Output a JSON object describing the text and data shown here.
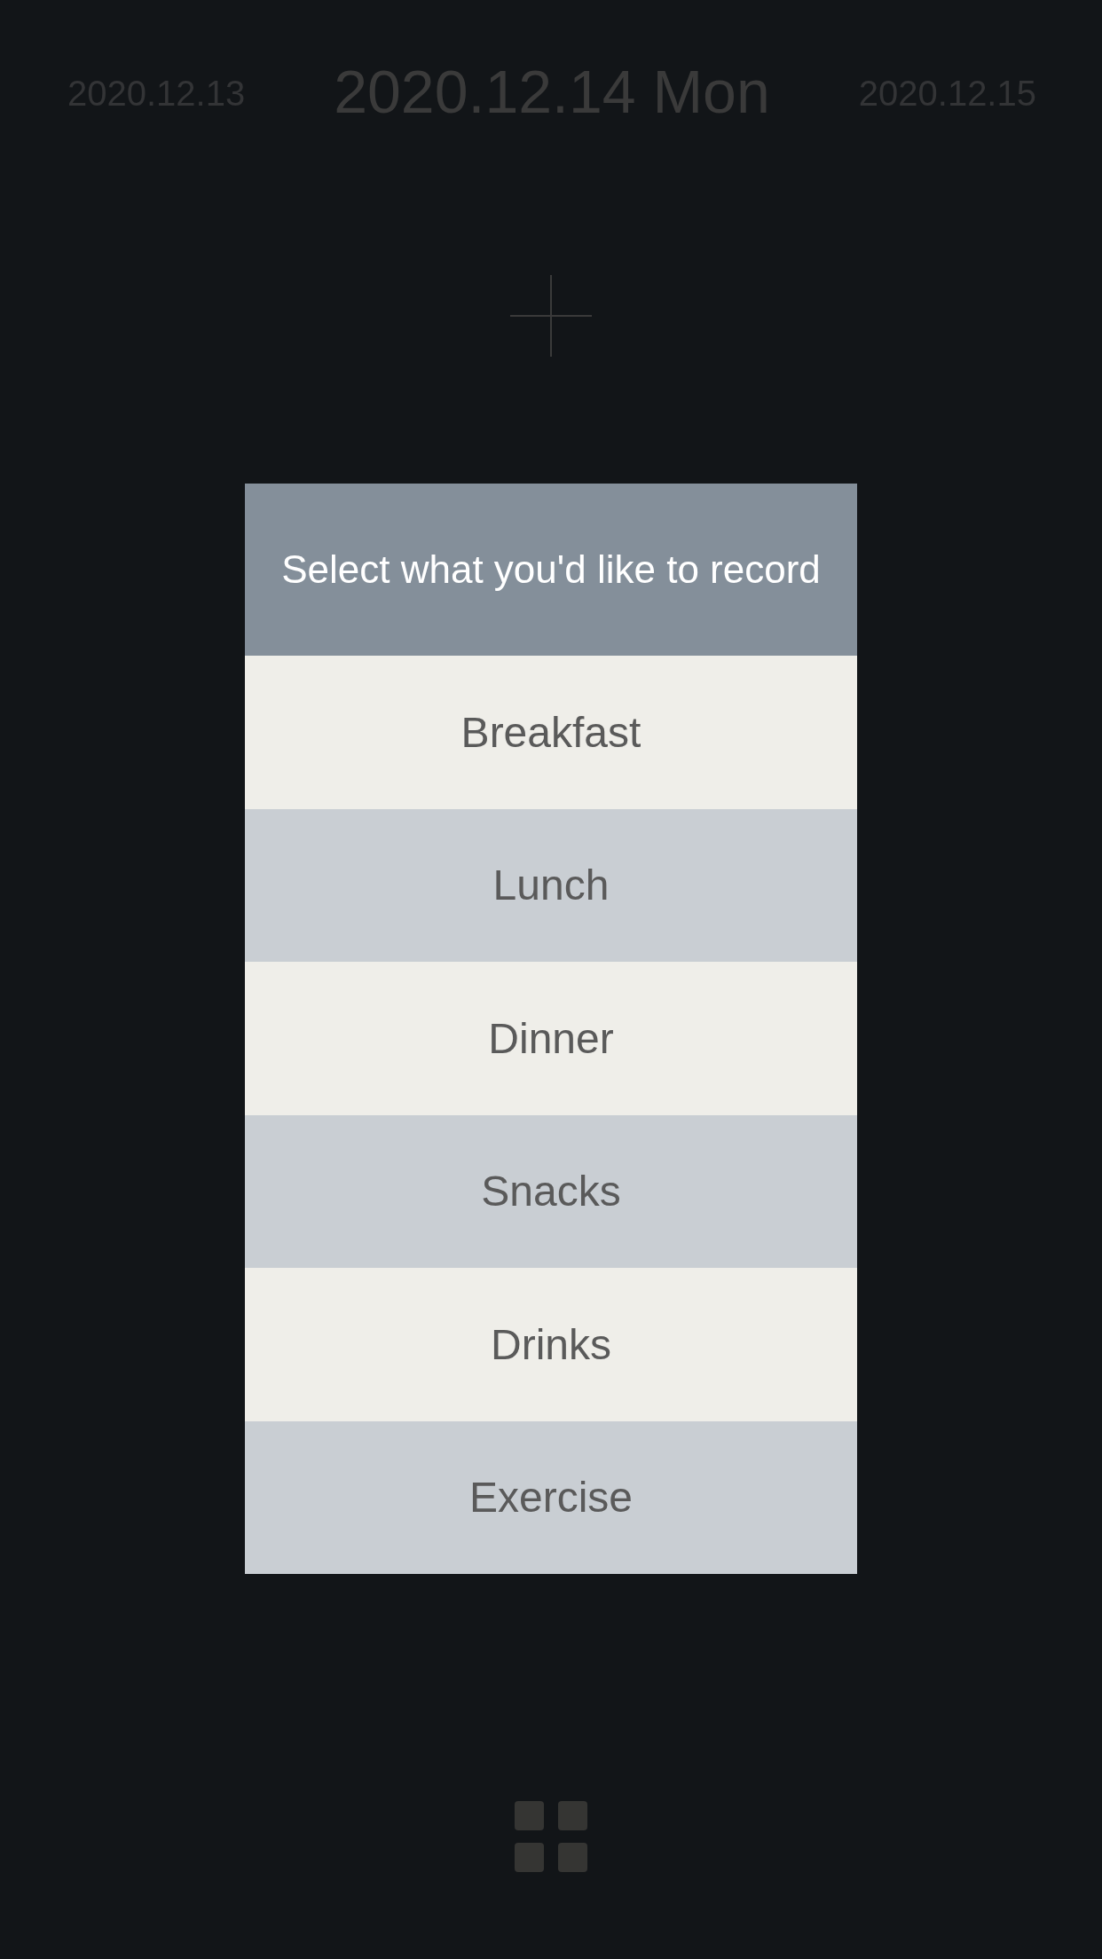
{
  "date_nav": {
    "previous": "2020.12.13",
    "current": "2020.12.14 Mon",
    "next": "2020.12.15"
  },
  "dialog": {
    "title": "Select what you'd like to record",
    "options": [
      {
        "label": "Breakfast"
      },
      {
        "label": "Lunch"
      },
      {
        "label": "Dinner"
      },
      {
        "label": "Snacks"
      },
      {
        "label": "Drinks"
      },
      {
        "label": "Exercise"
      }
    ]
  }
}
